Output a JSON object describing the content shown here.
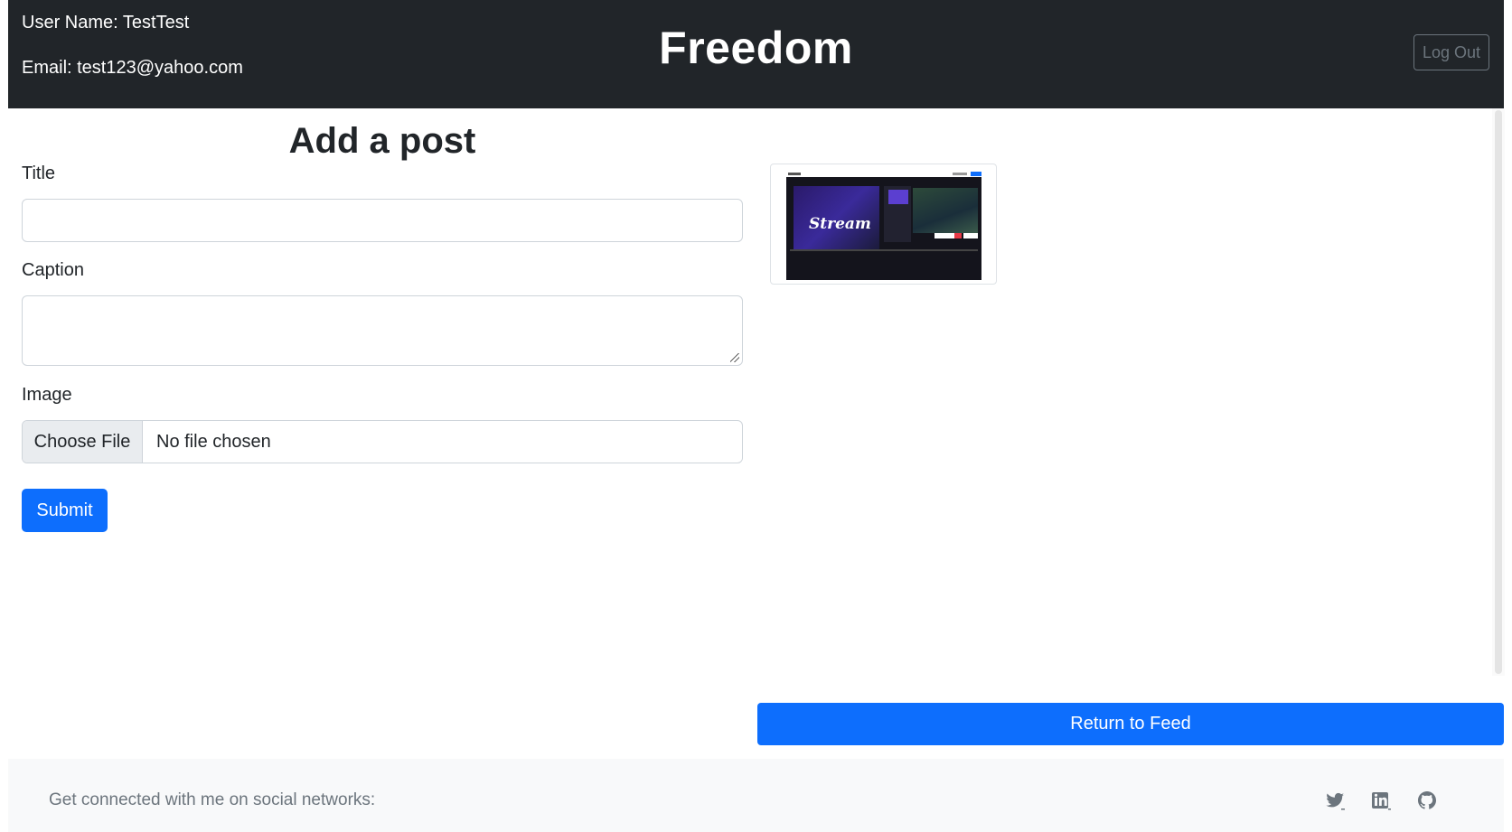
{
  "header": {
    "user_name": "User Name: TestTest",
    "email": "Email: test123@yahoo.com",
    "brand": "Freedom",
    "logout_label": "Log Out"
  },
  "form": {
    "title": "Add a post",
    "title_label": "Title",
    "title_value": "",
    "caption_label": "Caption",
    "caption_value": "",
    "image_label": "Image",
    "choose_file_label": "Choose File",
    "file_status": "No file chosen",
    "submit_label": "Submit"
  },
  "preview": {
    "image_text": "Stream"
  },
  "return_label": "Return to Feed",
  "footer": {
    "text": "Get connected with me on social networks:",
    "social_icons": [
      "twitter-icon",
      "linkedin-icon",
      "github-icon"
    ]
  },
  "colors": {
    "header_bg": "#212529",
    "primary": "#0d6efd",
    "footer_bg": "#f8f9fa",
    "muted": "#6c757d"
  }
}
